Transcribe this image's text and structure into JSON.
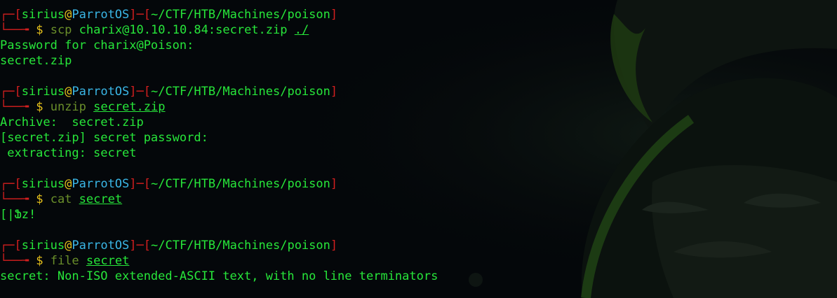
{
  "prompt": {
    "user": "sirius",
    "at": "@",
    "host": "ParrotOS",
    "path": "~/CTF/HTB/Machines/poison",
    "top_open": "┌─[",
    "mid": "]─[",
    "close": "]",
    "bottom": "└──╼",
    "dollar": "$"
  },
  "blocks": [
    {
      "command": "scp",
      "args": [
        {
          "text": "charix@10.10.10.84:secret.zip",
          "underline": false
        },
        {
          "text": "./",
          "underline": true
        }
      ],
      "output": [
        "Password for charix@Poison:",
        "secret.zip"
      ]
    },
    {
      "command": "unzip",
      "args": [
        {
          "text": "secret.zip",
          "underline": true
        }
      ],
      "output": [
        "Archive:  secret.zip",
        "[secret.zip] secret password:",
        " extracting: secret"
      ]
    },
    {
      "command": "cat",
      "args": [
        {
          "text": "secret",
          "underline": true
        }
      ],
      "output": [
        "[|Ֆz!"
      ]
    },
    {
      "command": "file",
      "args": [
        {
          "text": "secret",
          "underline": true
        }
      ],
      "output": [
        "secret: Non-ISO extended-ASCII text, with no line terminators"
      ]
    }
  ],
  "colors": {
    "background": "#04070a",
    "prompt_frame": "#d41f1f",
    "user": "#27e63a",
    "at": "#e8c31b",
    "host": "#3ab6e6",
    "path": "#27e63a",
    "command": "#6a8f2a",
    "output": "#27e63a"
  },
  "wallpaper": {
    "icon": "hooded-parrot-mascot-icon"
  }
}
